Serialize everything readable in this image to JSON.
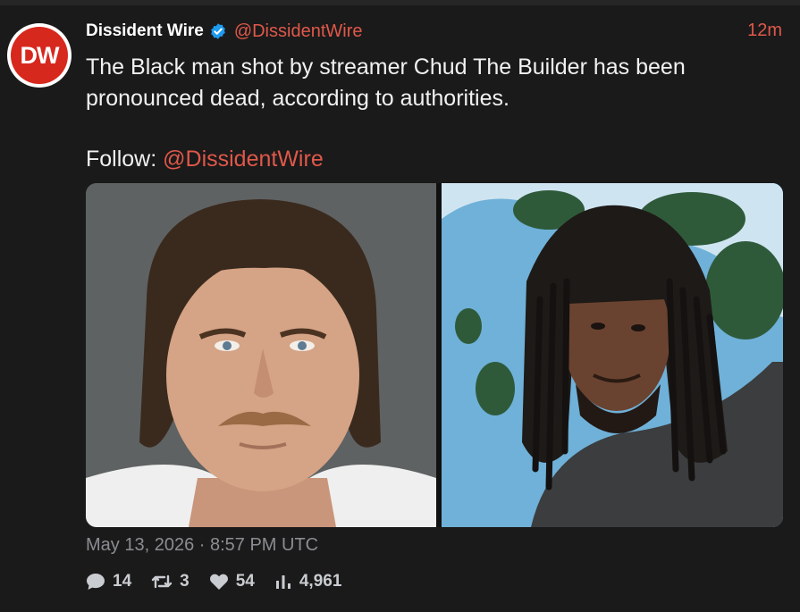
{
  "tweet": {
    "avatar_initials": "DW",
    "author_name": "Dissident Wire",
    "handle": "@DissidentWire",
    "time_ago": "12m",
    "text": "The Black man shot by streamer Chud The Builder has been pronounced dead, according to authorities.",
    "follow_prefix": "Follow: ",
    "follow_handle": "@DissidentWire",
    "date": "May 13, 2026 · 8:57 PM UTC"
  },
  "stats": {
    "replies": "14",
    "retweets": "3",
    "likes": "54",
    "views": "4,961"
  },
  "icons": {
    "verified": "verified-badge-icon",
    "reply": "comment-bubble-icon",
    "retweet": "retweet-icon",
    "like": "heart-icon",
    "views": "bar-chart-icon"
  },
  "colors": {
    "background": "#1a1a1a",
    "accent": "#e0584a",
    "avatar_red": "#d7281e",
    "verified_blue": "#1d9bf0"
  }
}
